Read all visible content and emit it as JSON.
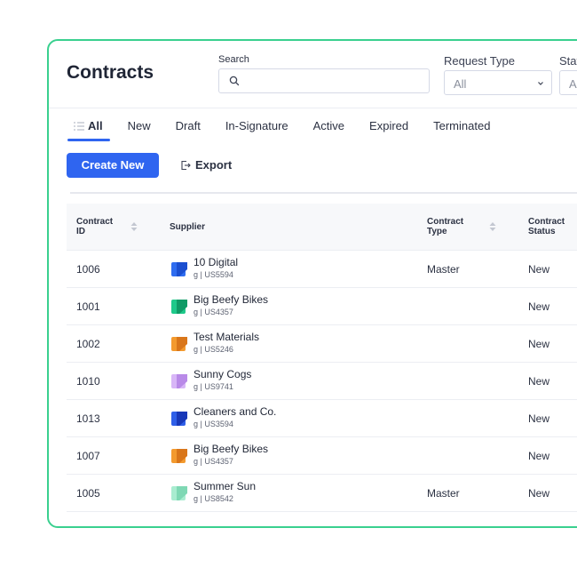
{
  "page": {
    "title": "Contracts"
  },
  "filters": {
    "search_label": "Search",
    "search_placeholder": "",
    "request_type_label": "Request Type",
    "request_type_value": "All",
    "status_label": "Stat",
    "status_value": "Al"
  },
  "tabs": [
    "All",
    "New",
    "Draft",
    "In-Signature",
    "Active",
    "Expired",
    "Terminated"
  ],
  "actions": {
    "create": "Create New",
    "export": "Export"
  },
  "colors": {
    "accent": "#2f65f0",
    "frame": "#3ad08f"
  },
  "table": {
    "columns": {
      "contract_id": [
        "Contract",
        "ID"
      ],
      "supplier": "Supplier",
      "contract_type": [
        "Contract",
        "Type"
      ],
      "contract_status": [
        "Contract",
        "Status"
      ]
    },
    "rows": [
      {
        "id": "1006",
        "supplier": "10 Digital",
        "sub": "g | US5594",
        "type": "Master",
        "status": "New",
        "logo": [
          "#2f6df0",
          "#1b4fd0"
        ],
        "icon": "supplier-logo-icon"
      },
      {
        "id": "1001",
        "supplier": "Big Beefy Bikes",
        "sub": "g | US4357",
        "type": "",
        "status": "New",
        "logo": [
          "#1ec98a",
          "#0f9b66"
        ],
        "icon": "supplier-logo-icon"
      },
      {
        "id": "1002",
        "supplier": "Test Materials",
        "sub": "g | US5246",
        "type": "",
        "status": "New",
        "logo": [
          "#f39a2e",
          "#d9761a"
        ],
        "icon": "supplier-logo-icon"
      },
      {
        "id": "1010",
        "supplier": "Sunny Cogs",
        "sub": "g | US9741",
        "type": "",
        "status": "New",
        "logo": [
          "#d8b6f7",
          "#b98ae8"
        ],
        "icon": "supplier-logo-icon"
      },
      {
        "id": "1013",
        "supplier": "Cleaners and Co.",
        "sub": "g | US3594",
        "type": "",
        "status": "New",
        "logo": [
          "#2f5fe8",
          "#1838b8"
        ],
        "icon": "supplier-logo-icon"
      },
      {
        "id": "1007",
        "supplier": "Big Beefy Bikes",
        "sub": "g | US4357",
        "type": "",
        "status": "New",
        "logo": [
          "#f39a2e",
          "#d9761a"
        ],
        "icon": "supplier-logo-icon"
      },
      {
        "id": "1005",
        "supplier": "Summer Sun",
        "sub": "g | US8542",
        "type": "Master",
        "status": "New",
        "logo": [
          "#a9ecd0",
          "#7fd8b4"
        ],
        "icon": "supplier-logo-icon"
      }
    ]
  }
}
